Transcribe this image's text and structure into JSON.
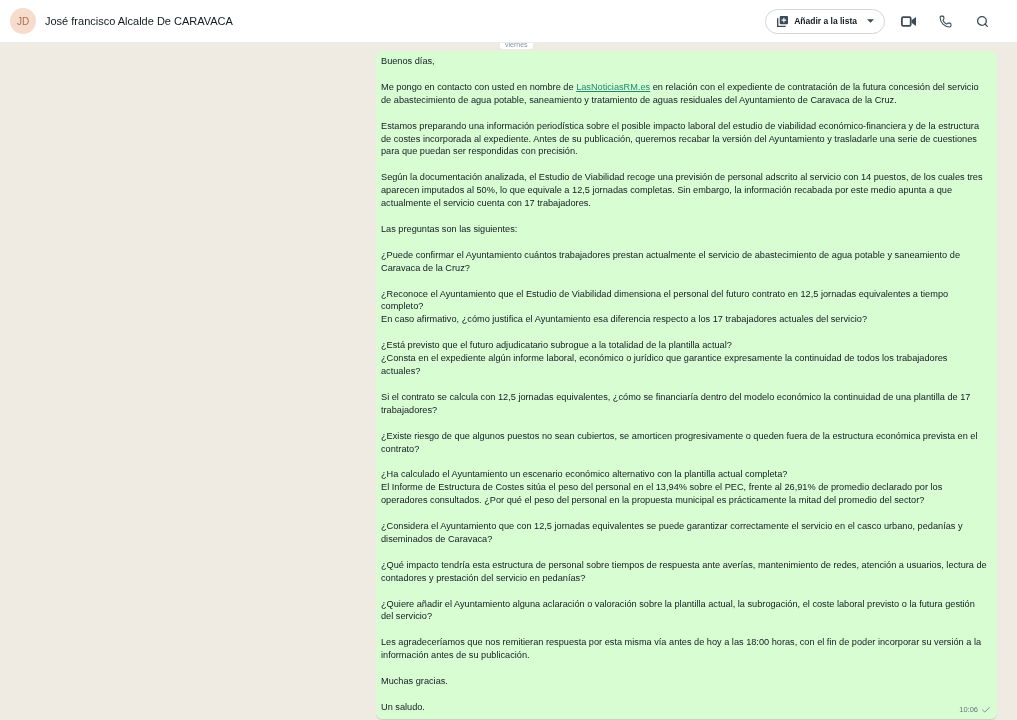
{
  "chat_header": {
    "avatar_initials": "JD",
    "contact_name": "José francisco Alcalde De CARAVACA",
    "add_to_list_button": "Añadir a la lista"
  },
  "date_chip": "viernes",
  "message": {
    "paragraphs": [
      {
        "kind": "text",
        "lines": [
          "Buenos días,"
        ]
      },
      {
        "kind": "link",
        "before": "Me pongo en contacto con usted en nombre de",
        "link": "LasNoticiasRM.es",
        "after": "en relación con el expediente de contratación de la futura concesión del servicio de abastecimiento de agua potable, saneamiento y tratamiento de aguas residuales del Ayuntamiento de Caravaca de la Cruz."
      },
      {
        "kind": "text",
        "lines": [
          "Estamos preparando una información periodística sobre el posible impacto laboral del estudio de viabilidad económico-financiera y de la estructura de costes incorporada al expediente. Antes de su publicación, queremos recabar la versión del Ayuntamiento y trasladarle una serie de cuestiones para que puedan ser respondidas con precisión."
        ]
      },
      {
        "kind": "text",
        "lines": [
          "Según la documentación analizada, el Estudio de Viabilidad recoge una previsión de personal adscrito al servicio con 14 puestos, de los cuales tres aparecen imputados al 50%, lo que equivale a 12,5 jornadas completas. Sin embargo, la información recabada por este medio apunta a que actualmente el servicio cuenta con 17 trabajadores."
        ]
      },
      {
        "kind": "text",
        "lines": [
          "Las preguntas son las siguientes:"
        ]
      },
      {
        "kind": "text",
        "lines": [
          "¿Puede confirmar el Ayuntamiento cuántos trabajadores prestan actualmente el servicio de abastecimiento de agua potable y saneamiento de Caravaca de la Cruz?"
        ]
      },
      {
        "kind": "text",
        "lines": [
          "¿Reconoce el Ayuntamiento que el Estudio de Viabilidad dimensiona el personal del futuro contrato en 12,5 jornadas equivalentes a tiempo completo?",
          "En caso afirmativo, ¿cómo justifica el Ayuntamiento esa diferencia respecto a los 17 trabajadores actuales del servicio?"
        ]
      },
      {
        "kind": "text",
        "lines": [
          "¿Está previsto que el futuro adjudicatario subrogue a la totalidad de la plantilla actual?",
          "¿Consta en el expediente algún informe laboral, económico o jurídico que garantice expresamente la continuidad de todos los trabajadores actuales?"
        ]
      },
      {
        "kind": "text",
        "lines": [
          "Si el contrato se calcula con 12,5 jornadas equivalentes, ¿cómo se financiaría dentro del modelo económico la continuidad de una plantilla de 17 trabajadores?"
        ]
      },
      {
        "kind": "text",
        "lines": [
          "¿Existe riesgo de que algunos puestos no sean cubiertos, se amorticen progresivamente o queden fuera de la estructura económica prevista en el contrato?"
        ]
      },
      {
        "kind": "text",
        "lines": [
          "¿Ha calculado el Ayuntamiento un escenario económico alternativo con la plantilla actual completa?",
          "El Informe de Estructura de Costes sitúa el peso del personal en el 13,94% sobre el PEC, frente al 26,91% de promedio declarado por los operadores consultados. ¿Por qué el peso del personal en la propuesta municipal es prácticamente la mitad del promedio del sector?"
        ]
      },
      {
        "kind": "text",
        "lines": [
          "¿Considera el Ayuntamiento que con 12,5 jornadas equivalentes se puede garantizar correctamente el servicio en el casco urbano, pedanías y diseminados de Caravaca?"
        ]
      },
      {
        "kind": "text",
        "lines": [
          "¿Qué impacto tendría esta estructura de personal sobre tiempos de respuesta ante averías, mantenimiento de redes, atención a usuarios, lectura de contadores y prestación del servicio en pedanías?"
        ]
      },
      {
        "kind": "text",
        "lines": [
          "¿Quiere añadir el Ayuntamiento alguna aclaración o valoración sobre la plantilla actual, la subrogación, el coste laboral previsto o la futura gestión del servicio?"
        ]
      },
      {
        "kind": "text",
        "lines": [
          "Les agradeceríamos que nos remitieran respuesta por esta misma vía antes de hoy a las 18:00 horas, con el fin de poder incorporar su versión a la información antes de su publicación."
        ]
      },
      {
        "kind": "text",
        "lines": [
          "Muchas gracias."
        ]
      },
      {
        "kind": "text",
        "lines": [
          "Un saludo."
        ]
      }
    ],
    "time": "10:06",
    "delivered": false
  }
}
